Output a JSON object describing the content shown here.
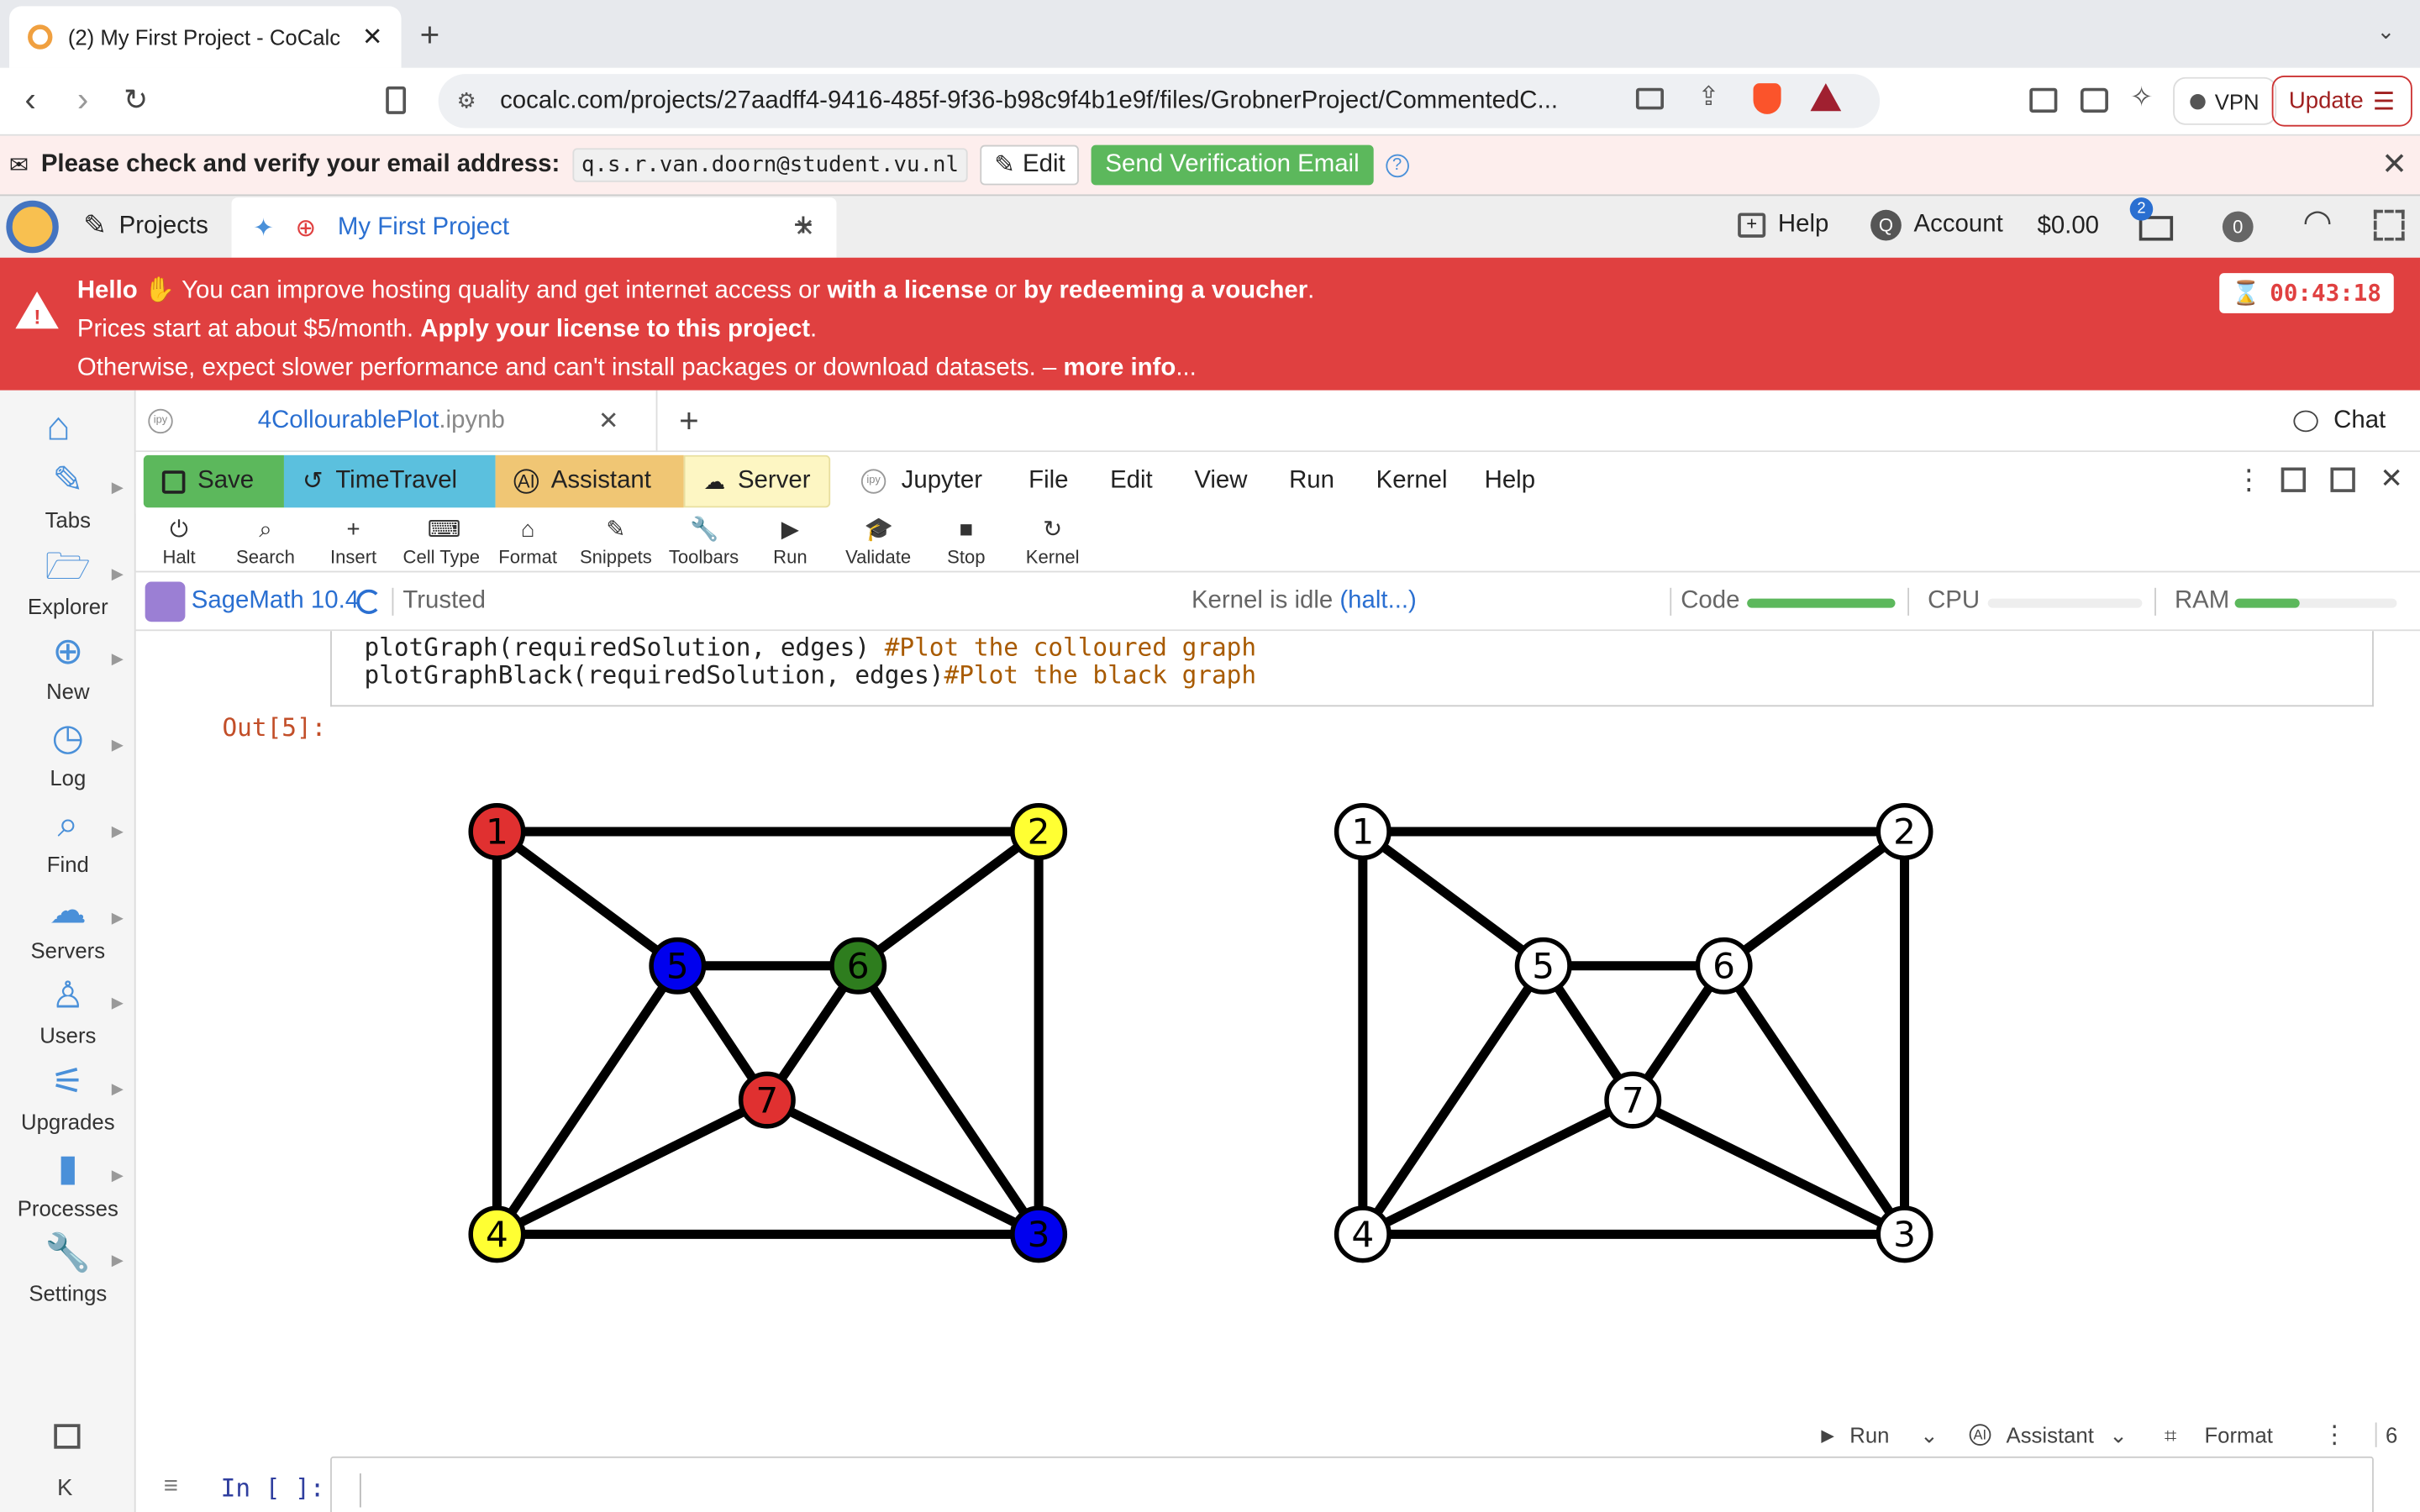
{
  "browser": {
    "tab_title": "(2) My First Project - CoCalc",
    "url": "cocalc.com/projects/27aadff4-9416-485f-9f36-b98c9f4b1e9f/files/GrobnerProject/CommentedC...",
    "vpn_label": "VPN",
    "update_label": "Update"
  },
  "email_banner": {
    "message": "Please check and verify your email address:",
    "email": "q.s.r.van.doorn@student.vu.nl",
    "edit_label": "Edit",
    "send_label": "Send Verification Email"
  },
  "topnav": {
    "projects_label": "Projects",
    "project_tab": "My First Project",
    "help_label": "Help",
    "account_initial": "Q",
    "account_label": "Account",
    "balance": "$0.00",
    "notif_count": "2",
    "counter": "0"
  },
  "license_banner": {
    "hello": "Hello",
    "line1_a": "You can improve hosting quality and get internet access or",
    "line1_b": "with a license",
    "line1_c": "or",
    "line1_d": "by redeeming a voucher",
    "line1_e": ".",
    "line2_a": "Prices start at about $5/month.",
    "line2_b": "Apply your license to this project",
    "line2_c": ".",
    "line3_a": "Otherwise, expect slower performance and can't install packages or download datasets. –",
    "line3_b": "more info",
    "line3_c": "...",
    "timer": "00:43:18"
  },
  "sidebar": {
    "items": [
      {
        "label": "Tabs",
        "icon": "pencil-icon"
      },
      {
        "label": "Explorer",
        "icon": "folder-icon"
      },
      {
        "label": "New",
        "icon": "plus-circle-icon"
      },
      {
        "label": "Log",
        "icon": "history-icon"
      },
      {
        "label": "Find",
        "icon": "search-icon"
      },
      {
        "label": "Servers",
        "icon": "server-icon"
      },
      {
        "label": "Users",
        "icon": "user-plus-icon"
      },
      {
        "label": "Upgrades",
        "icon": "sliders-icon"
      },
      {
        "label": "Processes",
        "icon": "chip-icon"
      },
      {
        "label": "Settings",
        "icon": "wrench-icon"
      }
    ]
  },
  "file_tab": {
    "name": "4CollourablePlot",
    "ext": ".ipynb",
    "chat_label": "Chat"
  },
  "menubar": {
    "save": "Save",
    "timetravel": "TimeTravel",
    "assistant": "Assistant",
    "server": "Server",
    "jupyter": "Jupyter",
    "file": "File",
    "edit": "Edit",
    "view": "View",
    "run": "Run",
    "kernel": "Kernel",
    "help": "Help",
    "colors": {
      "save": "#5cb85c",
      "timetravel": "#5bc0de",
      "assistant": "#f0c674",
      "server": "#fdf6c3"
    }
  },
  "iconbar": {
    "items": [
      "Halt",
      "Search",
      "Insert",
      "Cell Type",
      "Format",
      "Snippets",
      "Toolbars",
      "Run",
      "Validate",
      "Stop",
      "Kernel"
    ]
  },
  "status": {
    "kernel_name": "SageMath 10.4",
    "trusted": "Trusted",
    "kernel_state": "Kernel is idle",
    "halt_link": "(halt...)",
    "code_label": "Code",
    "cpu_label": "CPU",
    "ram_label": "RAM",
    "code_level": 1.0,
    "cpu_level": 0.0,
    "ram_level": 0.4
  },
  "notebook": {
    "code_line1_code": "plotGraph(requiredSolution, edges) ",
    "code_line1_comment": "#Plot the colloured graph",
    "code_line2_code": "plotGraphBlack(requiredSolution, edges)",
    "code_line2_comment": "#Plot the black graph",
    "out_prompt": "Out[5]:",
    "in_prompt": "In [ ]:",
    "cell_toolbar": {
      "run": "Run",
      "assistant": "Assistant",
      "format": "Format",
      "count": "6"
    }
  },
  "graphs": {
    "vertex_labels": [
      "1",
      "2",
      "3",
      "4",
      "5",
      "6",
      "7"
    ],
    "edges": [
      [
        1,
        2
      ],
      [
        2,
        3
      ],
      [
        3,
        4
      ],
      [
        1,
        4
      ],
      [
        1,
        5
      ],
      [
        5,
        6
      ],
      [
        2,
        6
      ],
      [
        5,
        7
      ],
      [
        6,
        7
      ],
      [
        4,
        5
      ],
      [
        4,
        7
      ],
      [
        3,
        7
      ],
      [
        3,
        6
      ]
    ],
    "colored_vertices": {
      "1": "#e03030",
      "2": "#ffff33",
      "3": "#0000ee",
      "4": "#ffff33",
      "5": "#0000ee",
      "6": "#2e7d1e",
      "7": "#e03030"
    },
    "black_vertex_color": "#ffffff"
  }
}
